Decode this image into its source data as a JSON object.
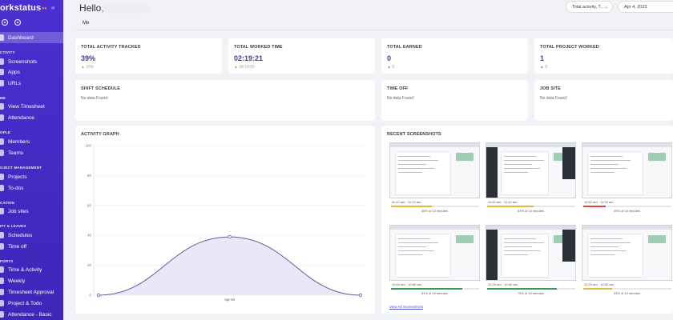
{
  "app": {
    "logo": "orkstatus",
    "logo_dots": "••",
    "collapse_icon": "«"
  },
  "sidebar": {
    "items": [
      {
        "label": "Dashboard",
        "icon": "grid-icon",
        "active": true
      },
      {
        "label": "Screenshots",
        "icon": "image-icon"
      },
      {
        "label": "Apps",
        "icon": "apps-icon"
      },
      {
        "label": "URLs",
        "icon": "link-icon"
      },
      {
        "label": "View Timesheet",
        "icon": "clock-icon"
      },
      {
        "label": "Attendance",
        "icon": "calendar-icon"
      },
      {
        "label": "Members",
        "icon": "user-icon"
      },
      {
        "label": "Teams",
        "icon": "team-icon"
      },
      {
        "label": "Projects",
        "icon": "folder-icon"
      },
      {
        "label": "To-dos",
        "icon": "check-icon"
      },
      {
        "label": "Job sites",
        "icon": "pin-icon"
      },
      {
        "label": "Schedules",
        "icon": "schedule-icon"
      },
      {
        "label": "Time off",
        "icon": "timeoff-icon"
      },
      {
        "label": "Time & Activity",
        "icon": "activity-icon"
      },
      {
        "label": "Weekly",
        "icon": "week-icon"
      },
      {
        "label": "Timesheet Approval",
        "icon": "approval-icon"
      },
      {
        "label": "Project & Todo",
        "icon": "report-icon"
      },
      {
        "label": "Attendance - Basic",
        "icon": "attendance-icon"
      }
    ],
    "sections": [
      "CTIVITY",
      "ME",
      "OPLE",
      "OJECT MANAGEMENT",
      "CATION",
      "IFT & LEAVES",
      "PORTS"
    ]
  },
  "header": {
    "greeting": "Hello,",
    "filter_dropdown": "Total activity, T...",
    "date_value": "Apr 4, 2023",
    "tab": "Me"
  },
  "stats": [
    {
      "title": "TOTAL ACTIVITY TRACKED",
      "value": "39%",
      "delta": "16%"
    },
    {
      "title": "TOTAL WORKED TIME",
      "value": "02:19:21",
      "delta": "08:14:50"
    },
    {
      "title": "TOTAL EARNED",
      "value": "0",
      "delta": "0"
    },
    {
      "title": "TOTAL PROJECT WORKED",
      "value": "1",
      "delta": "0"
    }
  ],
  "info_cards": [
    {
      "title": "SHIFT SCHEDULE",
      "text": "No data Found"
    },
    {
      "title": "TIME OFF",
      "text": "No data Found"
    },
    {
      "title": "JOB SITE",
      "text": "No data Found"
    }
  ],
  "activity_graph": {
    "title": "ACTIVITY GRAPH"
  },
  "chart_data": {
    "type": "area",
    "title": "ACTIVITY GRAPH",
    "xlabel": "",
    "ylabel": "",
    "ylim": [
      0,
      100
    ],
    "yticks": [
      0,
      20,
      40,
      60,
      80,
      100
    ],
    "x_label_center": "Apr 04",
    "points": [
      0,
      39,
      0
    ],
    "grid": true
  },
  "screenshots": {
    "title": "RECENT SCREENSHOTS",
    "view_all": "View All Screenshots",
    "items": [
      {
        "time": "11:10 am - 11:19 am",
        "pct": "46% of 10 minutes",
        "progress": 0.46,
        "color": "#e2b93b"
      },
      {
        "time": "11:00 am - 11:10 am",
        "pct": "53% of 10 minutes",
        "progress": 0.53,
        "color": "#e2b93b"
      },
      {
        "time": "10:50 am - 11:00 am",
        "pct": "25% of 10 minutes",
        "progress": 0.25,
        "color": "#d9463a"
      },
      {
        "time": "10:40 am - 10:50 am",
        "pct": "81% of 10 minutes",
        "progress": 0.81,
        "color": "#2e9e4f"
      },
      {
        "time": "10:30 am - 10:40 am",
        "pct": "79% of 10 minutes",
        "progress": 0.79,
        "color": "#2e9e4f"
      },
      {
        "time": "10:20 am - 10:30 am",
        "pct": "33% of 10 minutes",
        "progress": 0.33,
        "color": "#e2b93b"
      }
    ]
  }
}
